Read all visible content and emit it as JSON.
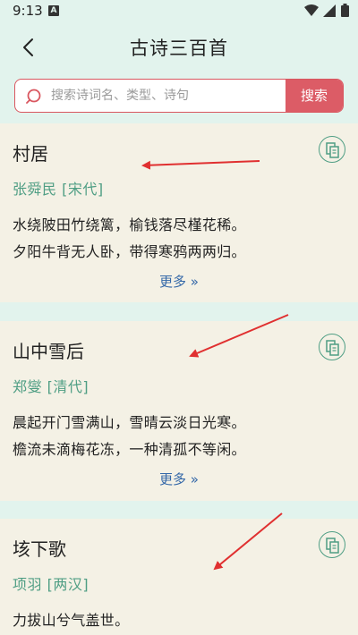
{
  "status_bar": {
    "time": "9:13",
    "notification_badge": "A"
  },
  "header": {
    "title": "古诗三百首"
  },
  "search": {
    "placeholder": "搜索诗词名、类型、诗句",
    "button_label": "搜索"
  },
  "poems": [
    {
      "title": "村居",
      "author": "张舜民 [宋代]",
      "lines": [
        "水绕陂田竹绕篱，榆钱落尽槿花稀。",
        "夕阳牛背无人卧，带得寒鸦两两归。"
      ],
      "more_label": "更多"
    },
    {
      "title": "山中雪后",
      "author": "郑燮 [清代]",
      "lines": [
        "晨起开门雪满山，雪晴云淡日光寒。",
        "檐流未滴梅花冻，一种清孤不等闲。"
      ],
      "more_label": "更多"
    },
    {
      "title": "垓下歌",
      "author": "项羽 [两汉]",
      "lines": [
        "力拔山兮气盖世。"
      ]
    }
  ],
  "colors": {
    "background": "#e2f3ed",
    "card": "#f4f1e5",
    "accent_red": "#dc5c66",
    "author_green": "#4f9e84",
    "link_blue": "#3468a8",
    "annotation_arrow": "#e03030"
  }
}
